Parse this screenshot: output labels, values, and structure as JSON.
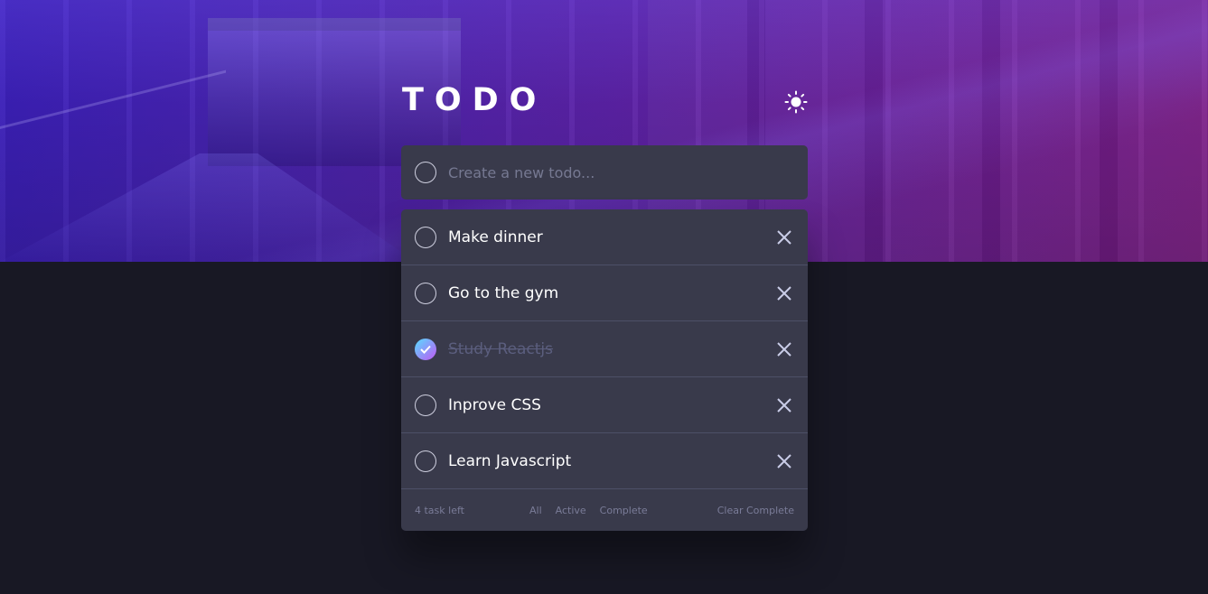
{
  "header": {
    "title": "TODO",
    "theme_icon": "sun-icon"
  },
  "new_todo": {
    "placeholder": "Create a new todo..."
  },
  "todos": [
    {
      "text": "Make dinner",
      "completed": false
    },
    {
      "text": "Go to the gym",
      "completed": false
    },
    {
      "text": "Study Reactjs",
      "completed": true
    },
    {
      "text": "Inprove CSS",
      "completed": false
    },
    {
      "text": "Learn Javascript",
      "completed": false
    }
  ],
  "footer": {
    "count_label": "4 task left",
    "filters": [
      "All",
      "Active",
      "Complete"
    ],
    "clear_label": "Clear Complete"
  },
  "colors": {
    "background": "#181824",
    "card": "#393a4b",
    "check_gradient_start": "#57ddff",
    "check_gradient_end": "#c058f3"
  }
}
